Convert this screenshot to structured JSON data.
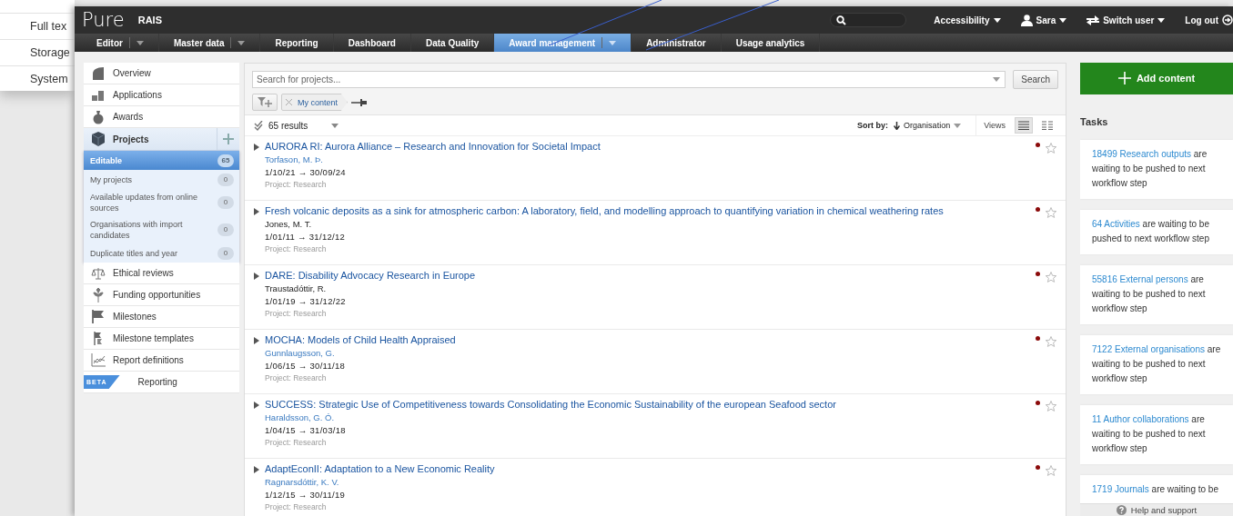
{
  "background_window": {
    "items": [
      "Full tex",
      "Storage",
      "System"
    ]
  },
  "header": {
    "logo": "Pure",
    "product": "RAIS",
    "menus": [
      {
        "label": "Accessibility",
        "kind": "menu"
      },
      {
        "label": "Sara",
        "kind": "user"
      },
      {
        "label": "Switch user",
        "kind": "switch"
      },
      {
        "label": "Log out",
        "kind": "logout"
      }
    ]
  },
  "nav": {
    "tabs": [
      {
        "label": "Editor",
        "dropdown": true,
        "selected": false
      },
      {
        "label": "Master data",
        "dropdown": true,
        "selected": false
      },
      {
        "label": "Reporting",
        "dropdown": false,
        "selected": false
      },
      {
        "label": "Dashboard",
        "dropdown": false,
        "selected": false
      },
      {
        "label": "Data Quality",
        "dropdown": false,
        "selected": false
      },
      {
        "label": "Award management",
        "dropdown": true,
        "selected": true
      },
      {
        "label": "Administrator",
        "dropdown": false,
        "selected": false
      },
      {
        "label": "Usage analytics",
        "dropdown": false,
        "selected": false
      }
    ]
  },
  "sidebar": {
    "items": [
      {
        "label": "Overview",
        "selected": false
      },
      {
        "label": "Applications",
        "selected": false
      },
      {
        "label": "Awards",
        "selected": false
      },
      {
        "label": "Projects",
        "selected": true,
        "expanded": true,
        "children": [
          {
            "label": "Editable",
            "count": "65",
            "selected": true
          },
          {
            "label": "My projects",
            "count": "0",
            "selected": false
          },
          {
            "label": "Available updates from online sources",
            "count": "0",
            "selected": false
          },
          {
            "label": "Organisations with import candidates",
            "count": "0",
            "selected": false
          },
          {
            "label": "Duplicate titles and year",
            "count": "0",
            "selected": false
          }
        ]
      },
      {
        "label": "Ethical reviews",
        "selected": false
      },
      {
        "label": "Funding opportunities",
        "selected": false
      },
      {
        "label": "Milestones",
        "selected": false
      },
      {
        "label": "Milestone templates",
        "selected": false
      },
      {
        "label": "Report definitions",
        "selected": false
      },
      {
        "label": "Reporting",
        "badge": "BETA",
        "selected": false
      }
    ]
  },
  "search": {
    "placeholder": "Search for projects...",
    "button": "Search"
  },
  "filters": [
    {
      "label": "My content"
    }
  ],
  "results": {
    "count": "65 results",
    "sort_label": "Sort by:",
    "sort_value": "Organisation",
    "views_label": "Views",
    "views": [
      {
        "kind": "list",
        "selected": true
      },
      {
        "kind": "grid",
        "selected": false
      }
    ]
  },
  "projects": [
    {
      "title": "AURORA RI: Aurora Alliance – Research and Innovation for Societal Impact",
      "person": "Torfason, M. Þ.",
      "person_linked": true,
      "dates": "1/10/21 → 30/09/24",
      "type": "Project: Research",
      "favourite": false
    },
    {
      "title": "Fresh volcanic deposits as a sink for atmospheric carbon: A laboratory, field, and modelling approach to quantifying variation in chemical weathering rates",
      "person": "Jones, M. T.",
      "person_linked": false,
      "dates": "1/01/11 → 31/12/12",
      "type": "Project: Research",
      "favourite": false
    },
    {
      "title": "DARE: Disability Advocacy Research in Europe",
      "person": "Traustadóttir, R.",
      "person_linked": false,
      "dates": "1/01/19 → 31/12/22",
      "type": "Project: Research",
      "favourite": false
    },
    {
      "title": "MOCHA: Models of Child Health Appraised",
      "person": "Gunnlaugsson, G.",
      "person_linked": true,
      "dates": "1/06/15 → 30/11/18",
      "type": "Project: Research",
      "favourite": false
    },
    {
      "title": "SUCCESS: Strategic Use of Competitiveness towards Consolidating the Economic Sustainability of the european Seafood sector",
      "person": "Haraldsson, G. Ó.",
      "person_linked": true,
      "dates": "1/04/15 → 31/03/18",
      "type": "Project: Research",
      "favourite": false
    },
    {
      "title": "AdaptEconII: Adaptation to a New Economic Reality",
      "person": "Ragnarsdóttir, K. V.",
      "person_linked": true,
      "dates": "1/12/15 → 30/11/19",
      "type": "Project: Research",
      "favourite": false
    }
  ],
  "add_button": "Add content",
  "tasks": {
    "title": "Tasks",
    "items": [
      {
        "link": "18499 Research outputs",
        "text": "are waiting to be pushed to next workflow step"
      },
      {
        "link": "64 Activities",
        "text": "are waiting to be pushed to next workflow step"
      },
      {
        "link": "55816 External persons",
        "text": "are waiting to be pushed to next workflow step"
      },
      {
        "link": "7122 External organisations",
        "text": "are waiting to be pushed to next workflow step"
      },
      {
        "link": "11 Author collaborations",
        "text": "are waiting to be pushed to next workflow step"
      },
      {
        "link": "1719 Journals",
        "text": "are waiting to be"
      }
    ]
  },
  "help": "Help and support"
}
